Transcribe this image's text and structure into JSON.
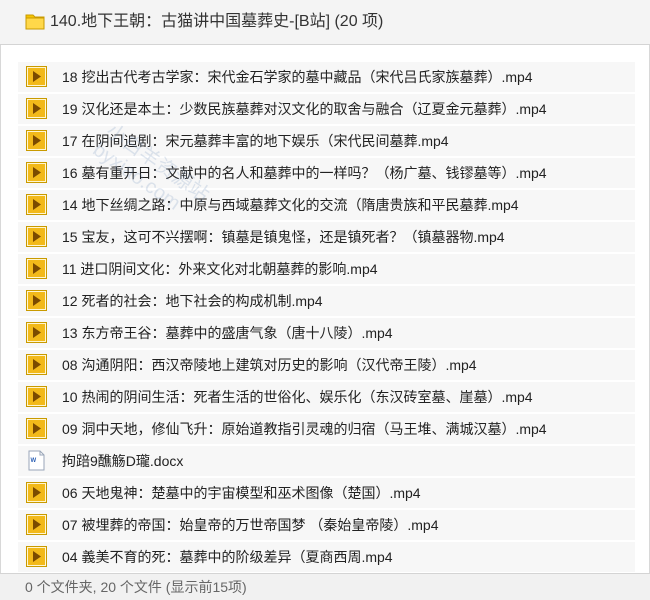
{
  "header": {
    "title": "140.地下王朝：古猫讲中国墓葬史-[B站] (20 项)",
    "icon": "folder-icon"
  },
  "watermark": {
    "line1": "小白羊资源站",
    "line2": "byxiao.com"
  },
  "colors": {
    "folder": "#f5c400",
    "media_icon": "#e8a400",
    "doc_icon": "#2b5fb4",
    "row_bg": "#f7f7f7",
    "header_bg": "#f4f4f4",
    "footer_bg": "#f1f1f1"
  },
  "files": [
    {
      "name": "18 挖出古代考古学家：宋代金石学家的墓中藏品（宋代吕氏家族墓葬）.mp4",
      "icon": "media-file-icon"
    },
    {
      "name": "19 汉化还是本土：少数民族墓葬对汉文化的取舍与融合（辽夏金元墓葬）.mp4",
      "icon": "media-file-icon"
    },
    {
      "name": "17 在阴间追剧：宋元墓葬丰富的地下娱乐（宋代民间墓葬.mp4",
      "icon": "media-file-icon"
    },
    {
      "name": "16 墓有重开日：文献中的名人和墓葬中的一样吗？（杨广墓、钱镠墓等）.mp4",
      "icon": "media-file-icon"
    },
    {
      "name": "14 地下丝绸之路：中原与西域墓葬文化的交流（隋唐贵族和平民墓葬.mp4",
      "icon": "media-file-icon"
    },
    {
      "name": "15 宝友，这可不兴摆啊：镇墓是镇鬼怪，还是镇死者？（镇墓器物.mp4",
      "icon": "media-file-icon"
    },
    {
      "name": "11 进口阴间文化：外来文化对北朝墓葬的影响.mp4",
      "icon": "media-file-icon"
    },
    {
      "name": "12 死者的社会：地下社会的构成机制.mp4",
      "icon": "media-file-icon"
    },
    {
      "name": "13 东方帝王谷：墓葬中的盛唐气象（唐十八陵）.mp4",
      "icon": "media-file-icon"
    },
    {
      "name": "08 沟通阴阳：西汉帝陵地上建筑对历史的影响（汉代帝王陵）.mp4",
      "icon": "media-file-icon"
    },
    {
      "name": "10 热闹的阴间生活：死者生活的世俗化、娱乐化（东汉砖室墓、崖墓）.mp4",
      "icon": "media-file-icon"
    },
    {
      "name": "09 洞中天地，修仙飞升：原始道教指引灵魂的归宿（马王堆、满城汉墓）.mp4",
      "icon": "media-file-icon"
    },
    {
      "name": "拘踣9醮觞D瓏.docx",
      "icon": "word-doc-icon"
    },
    {
      "name": "06 天地鬼神：楚墓中的宇宙模型和巫术图像（楚国）.mp4",
      "icon": "media-file-icon"
    },
    {
      "name": "07 被埋葬的帝国：始皇帝的万世帝国梦 （秦始皇帝陵）.mp4",
      "icon": "media-file-icon"
    },
    {
      "name": "04 義美不育的死：墓葬中的阶级差异（夏商西周.mp4",
      "icon": "media-file-icon"
    }
  ],
  "footer": {
    "status": "0 个文件夹, 20 个文件 (显示前15项)"
  }
}
